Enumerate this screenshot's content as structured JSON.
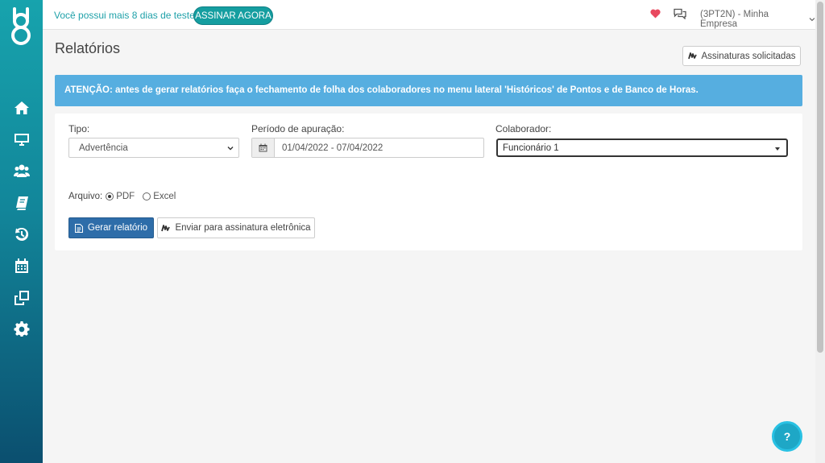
{
  "topbar": {
    "trial_text": "Você possui mais 8 dias de teste",
    "subscribe_label": "ASSINAR AGORA",
    "company_label": "(3PT2N) - Minha Empresa"
  },
  "sidebar": {
    "items": [
      {
        "icon": "home-icon"
      },
      {
        "icon": "monitor-icon"
      },
      {
        "icon": "users-icon"
      },
      {
        "icon": "book-icon"
      },
      {
        "icon": "history-icon"
      },
      {
        "icon": "calendar-icon"
      },
      {
        "icon": "clone-icon"
      },
      {
        "icon": "gear-icon"
      }
    ]
  },
  "page": {
    "title": "Relatórios",
    "signatures_label": "Assinaturas solicitadas",
    "alert": "ATENÇÃO: antes de gerar relatórios faça o fechamento de folha dos colaboradores no menu lateral 'Históricos' de Pontos e de Banco de Horas."
  },
  "form": {
    "type_label": "Tipo:",
    "type_value": "Advertência",
    "period_label": "Período de apuração:",
    "period_value": "01/04/2022 - 07/04/2022",
    "collaborator_label": "Colaborador:",
    "collaborator_value": "Funcionário 1",
    "file_label": "Arquivo:",
    "file_options": [
      "PDF",
      "Excel"
    ],
    "file_selected": "PDF",
    "generate_label": "Gerar relatório",
    "send_label": "Enviar para assinatura eletrônica"
  },
  "help": {
    "label": "?"
  },
  "colors": {
    "accent": "#159ea0",
    "primary": "#2e6da9",
    "alert": "#56aee0",
    "heart": "#e8495f"
  }
}
